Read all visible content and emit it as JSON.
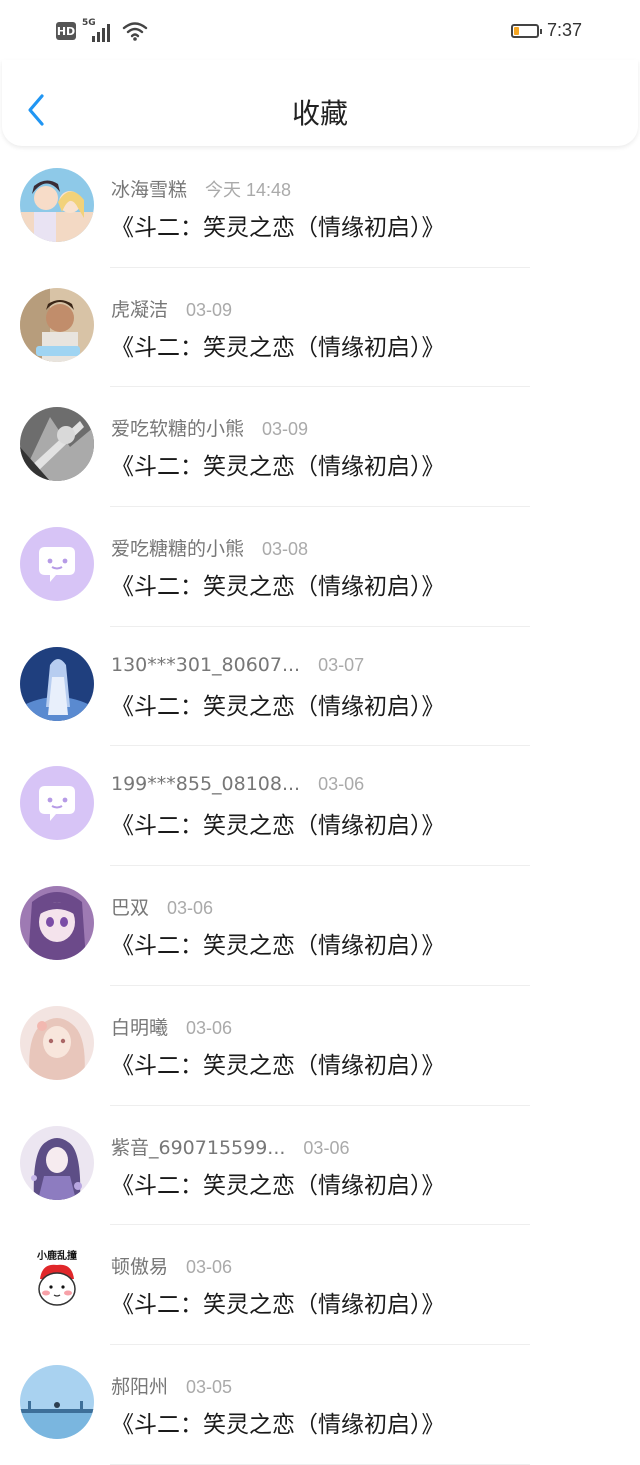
{
  "status_bar": {
    "hd": "HD",
    "network": "5G",
    "time": "7:37",
    "battery_level": 0.25,
    "battery_color": "#f5a623"
  },
  "header": {
    "title": "收藏",
    "back_icon": "chevron-left-icon",
    "accent": "#2196f3"
  },
  "favorites": [
    {
      "user": "冰海雪糕",
      "date": "今天 14:48",
      "book": "《斗二：笑灵之恋（情缘初启）》",
      "avatar": "anime-couple"
    },
    {
      "user": "虎凝洁",
      "date": "03-09",
      "book": "《斗二：笑灵之恋（情缘初启）》",
      "avatar": "photo-man"
    },
    {
      "user": "爱吃软糖的小熊",
      "date": "03-09",
      "book": "《斗二：笑灵之恋（情缘初启）》",
      "avatar": "anime-grey"
    },
    {
      "user": "爱吃糖糖的小熊",
      "date": "03-08",
      "book": "《斗二：笑灵之恋（情缘初启）》",
      "avatar": "default-chat"
    },
    {
      "user": "130***301_80607...",
      "date": "03-07",
      "book": "《斗二：笑灵之恋（情缘初启）》",
      "avatar": "anime-blue"
    },
    {
      "user": "199***855_08108...",
      "date": "03-06",
      "book": "《斗二：笑灵之恋（情缘初启）》",
      "avatar": "default-chat"
    },
    {
      "user": "巴双",
      "date": "03-06",
      "book": "《斗二：笑灵之恋（情缘初启）》",
      "avatar": "anime-purple"
    },
    {
      "user": "白明曦",
      "date": "03-06",
      "book": "《斗二：笑灵之恋（情缘初启）》",
      "avatar": "anime-pink"
    },
    {
      "user": "紫音_690715599...",
      "date": "03-06",
      "book": "《斗二：笑灵之恋（情缘初启）》",
      "avatar": "anime-violet"
    },
    {
      "user": "顿傲易",
      "date": "03-06",
      "book": "《斗二：笑灵之恋（情缘初启）》",
      "avatar": "cartoon-deer",
      "avatar_text": "小鹿乱撞"
    },
    {
      "user": "郝阳州",
      "date": "03-05",
      "book": "《斗二：笑灵之恋（情缘初启）》",
      "avatar": "photo-sky"
    }
  ]
}
